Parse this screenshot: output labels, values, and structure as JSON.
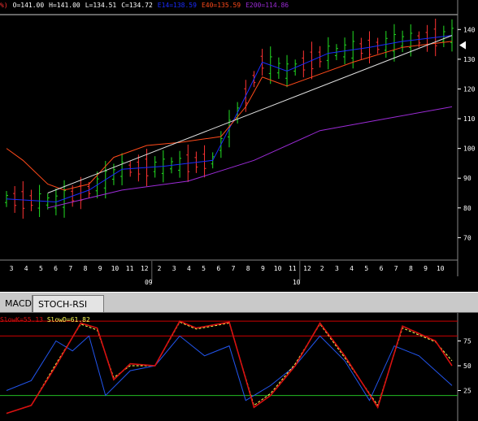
{
  "header": {
    "prefix": "%)",
    "open": "O=141.00",
    "high": "H=141.00",
    "low": "L=134.51",
    "close": "C=134.72",
    "ema14": "E14=138.59",
    "ema40": "E40=135.59",
    "ema200": "E200=114.86"
  },
  "tabs": {
    "macd": "MACD",
    "stoch": "STOCH-RSI"
  },
  "stoch_legend": {
    "slow": "SlowK=55.13",
    "fast": "SlowD=61.82"
  },
  "colors": {
    "background": "#000000",
    "up_bar": "#22dd22",
    "down_bar": "#ff3333",
    "ema14": "#1a2cff",
    "ema40": "#ff4a1a",
    "ema200": "#9b2bd6",
    "trendline": "#e0e0e0",
    "axis_text": "#ffffff",
    "stoch_k": "#d81010",
    "stoch_d": "#ffff55",
    "stoch_rsi": "#2255ee",
    "level_line": "#cc0000",
    "low_line": "#22bb22"
  },
  "chart_data": [
    {
      "type": "line",
      "title": "",
      "y_axis": {
        "ticks": [
          70,
          80,
          90,
          100,
          110,
          120,
          130,
          140
        ],
        "ylim": [
          63,
          145
        ]
      },
      "x_axis": {
        "tick_labels": [
          "3",
          "4",
          "5",
          "6",
          "7",
          "8",
          "9",
          "10",
          "11",
          "12",
          "2",
          "3",
          "4",
          "5",
          "6",
          "7",
          "8",
          "9",
          "10",
          "11",
          "12",
          "2",
          "3",
          "4",
          "5",
          "6",
          "7",
          "8",
          "9",
          "10"
        ],
        "year_labels": [
          {
            "label": "09",
            "after_tick_index": 9
          },
          {
            "label": "10",
            "after_tick_index": 19
          }
        ]
      },
      "last_price_marker": 134.7,
      "horizontal_line": 141,
      "series": [
        {
          "name": "E14",
          "color_key": "ema14",
          "points": [
            [
              0,
              83
            ],
            [
              6,
              82
            ],
            [
              10,
              86
            ],
            [
              14,
              93
            ],
            [
              19,
              94
            ],
            [
              25,
              96
            ],
            [
              28,
              112
            ],
            [
              31,
              129
            ],
            [
              34,
              126
            ],
            [
              39,
              132
            ],
            [
              44,
              134
            ],
            [
              48,
              136
            ],
            [
              54,
              138
            ]
          ]
        },
        {
          "name": "E40",
          "color_key": "ema40",
          "points": [
            [
              0,
              100
            ],
            [
              2,
              96
            ],
            [
              5,
              88
            ],
            [
              7,
              86
            ],
            [
              10,
              88
            ],
            [
              13,
              97
            ],
            [
              17,
              101
            ],
            [
              21,
              102
            ],
            [
              26,
              104
            ],
            [
              29,
              114
            ],
            [
              31,
              124
            ],
            [
              34,
              121
            ],
            [
              38,
              125
            ],
            [
              42,
              129
            ],
            [
              48,
              134
            ],
            [
              54,
              136
            ]
          ]
        },
        {
          "name": "E200",
          "color_key": "ema200",
          "points": [
            [
              5,
              80
            ],
            [
              14,
              86
            ],
            [
              22,
              89
            ],
            [
              30,
              96
            ],
            [
              38,
              106
            ],
            [
              46,
              110
            ],
            [
              54,
              114
            ]
          ]
        },
        {
          "name": "",
          "color_key": "trendline",
          "points": [
            [
              5,
              85
            ],
            [
              54,
              138
            ]
          ]
        }
      ]
    },
    {
      "type": "line",
      "title": "STOCH-RSI",
      "y_axis": {
        "ticks": [
          25,
          50,
          75
        ],
        "ylim": [
          0,
          100
        ]
      },
      "levels": [
        20,
        80
      ],
      "series": [
        {
          "name": "SlowK",
          "color_key": "stoch_k",
          "points": [
            [
              0,
              2
            ],
            [
              3,
              10
            ],
            [
              6,
              50
            ],
            [
              9,
              93
            ],
            [
              11,
              88
            ],
            [
              13,
              36
            ],
            [
              15,
              52
            ],
            [
              18,
              50
            ],
            [
              21,
              95
            ],
            [
              23,
              88
            ],
            [
              27,
              94
            ],
            [
              30,
              8
            ],
            [
              32,
              20
            ],
            [
              35,
              50
            ],
            [
              38,
              93
            ],
            [
              41,
              60
            ],
            [
              45,
              8
            ],
            [
              48,
              90
            ],
            [
              52,
              75
            ],
            [
              54,
              50
            ]
          ]
        },
        {
          "name": "SlowD",
          "color_key": "stoch_d",
          "points": [
            [
              0,
              2
            ],
            [
              3,
              10
            ],
            [
              6,
              52
            ],
            [
              9,
              92
            ],
            [
              11,
              86
            ],
            [
              13,
              38
            ],
            [
              15,
              50
            ],
            [
              18,
              50
            ],
            [
              21,
              94
            ],
            [
              23,
              87
            ],
            [
              27,
              93
            ],
            [
              30,
              10
            ],
            [
              32,
              22
            ],
            [
              35,
              52
            ],
            [
              38,
              92
            ],
            [
              41,
              58
            ],
            [
              45,
              10
            ],
            [
              48,
              88
            ],
            [
              52,
              74
            ],
            [
              54,
              55
            ]
          ]
        },
        {
          "name": "",
          "color_key": "stoch_rsi",
          "points": [
            [
              0,
              25
            ],
            [
              3,
              35
            ],
            [
              6,
              75
            ],
            [
              8,
              65
            ],
            [
              10,
              80
            ],
            [
              12,
              20
            ],
            [
              15,
              45
            ],
            [
              18,
              50
            ],
            [
              21,
              80
            ],
            [
              24,
              60
            ],
            [
              27,
              70
            ],
            [
              29,
              15
            ],
            [
              32,
              30
            ],
            [
              35,
              50
            ],
            [
              38,
              80
            ],
            [
              41,
              55
            ],
            [
              44,
              15
            ],
            [
              47,
              70
            ],
            [
              50,
              60
            ],
            [
              54,
              30
            ]
          ]
        }
      ]
    }
  ]
}
